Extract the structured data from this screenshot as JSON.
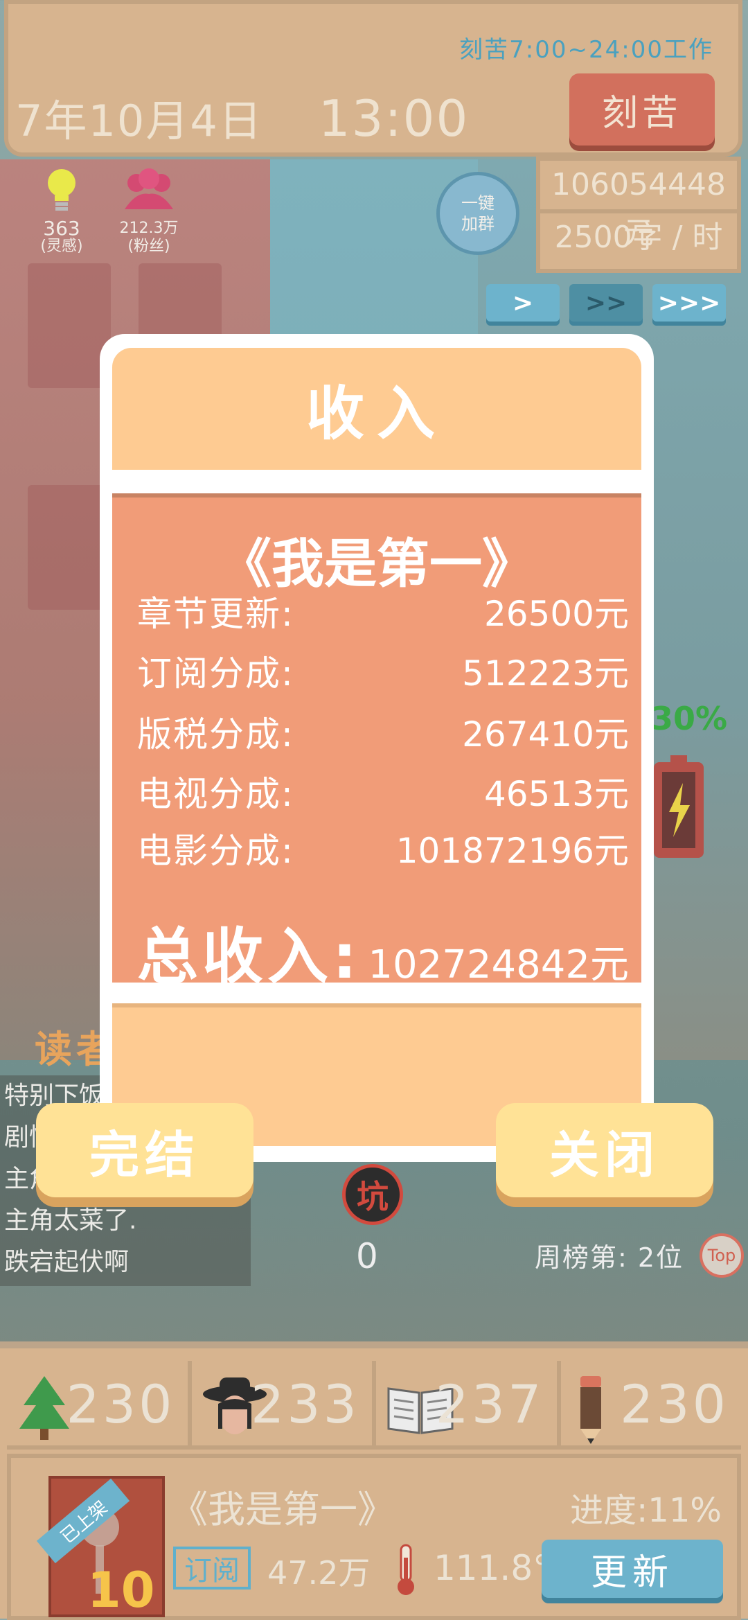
{
  "header": {
    "work_hours": "刻苦7:00~24:00工作",
    "date": "7年10月4日",
    "time": "13:00",
    "grind_button": "刻苦"
  },
  "wallet": {
    "money": "106054448元",
    "speed": "2500字 / 时"
  },
  "stats": {
    "inspiration_value": "363",
    "inspiration_label": "(灵感)",
    "fans_value": "212.3万",
    "fans_label": "(粉丝)"
  },
  "qq_group": {
    "line1": "一键",
    "line2": "加群"
  },
  "speed_buttons": [
    ">",
    ">>",
    ">>>"
  ],
  "battery_percent": "30%",
  "income_dialog": {
    "title": "收入",
    "book": "《我是第一》",
    "rows": [
      {
        "label": "章节更新:",
        "value": "26500元"
      },
      {
        "label": "订阅分成:",
        "value": "512223元"
      },
      {
        "label": "版税分成:",
        "value": "267410元"
      },
      {
        "label": "电视分成:",
        "value": "46513元"
      },
      {
        "label": "电影分成:",
        "value": "101872196元"
      }
    ],
    "total_label": "总收入:",
    "total_value": "102724842元"
  },
  "buttons": {
    "finish": "完结",
    "close": "关闭"
  },
  "reader_comments": {
    "title": "读者",
    "items": [
      "特别下饭",
      "剧情",
      "主角",
      "主角太菜了.",
      "跌宕起伏啊"
    ]
  },
  "pit": {
    "icon_text": "坑",
    "count": "0"
  },
  "weekly_rank": "周榜第: 2位",
  "top_badge": "Top",
  "attributes": [
    {
      "icon": "tree-icon",
      "value": "230"
    },
    {
      "icon": "character-icon",
      "value": "233"
    },
    {
      "icon": "book-icon",
      "value": "237"
    },
    {
      "icon": "pencil-icon",
      "value": "230"
    }
  ],
  "current_book": {
    "ribbon": "已上架",
    "cover_number": "10",
    "title": "《我是第一》",
    "progress": "进度:11%",
    "subscribe_badge": "订阅",
    "subscribers": "47.2万",
    "heat": "111.8°",
    "update_button": "更新"
  },
  "colors": {
    "panel": "#d7b48f",
    "dialog_header": "#fecb92",
    "dialog_body": "#f19c78",
    "action_blue": "#6db3cc",
    "grind_red": "#d2705d"
  }
}
